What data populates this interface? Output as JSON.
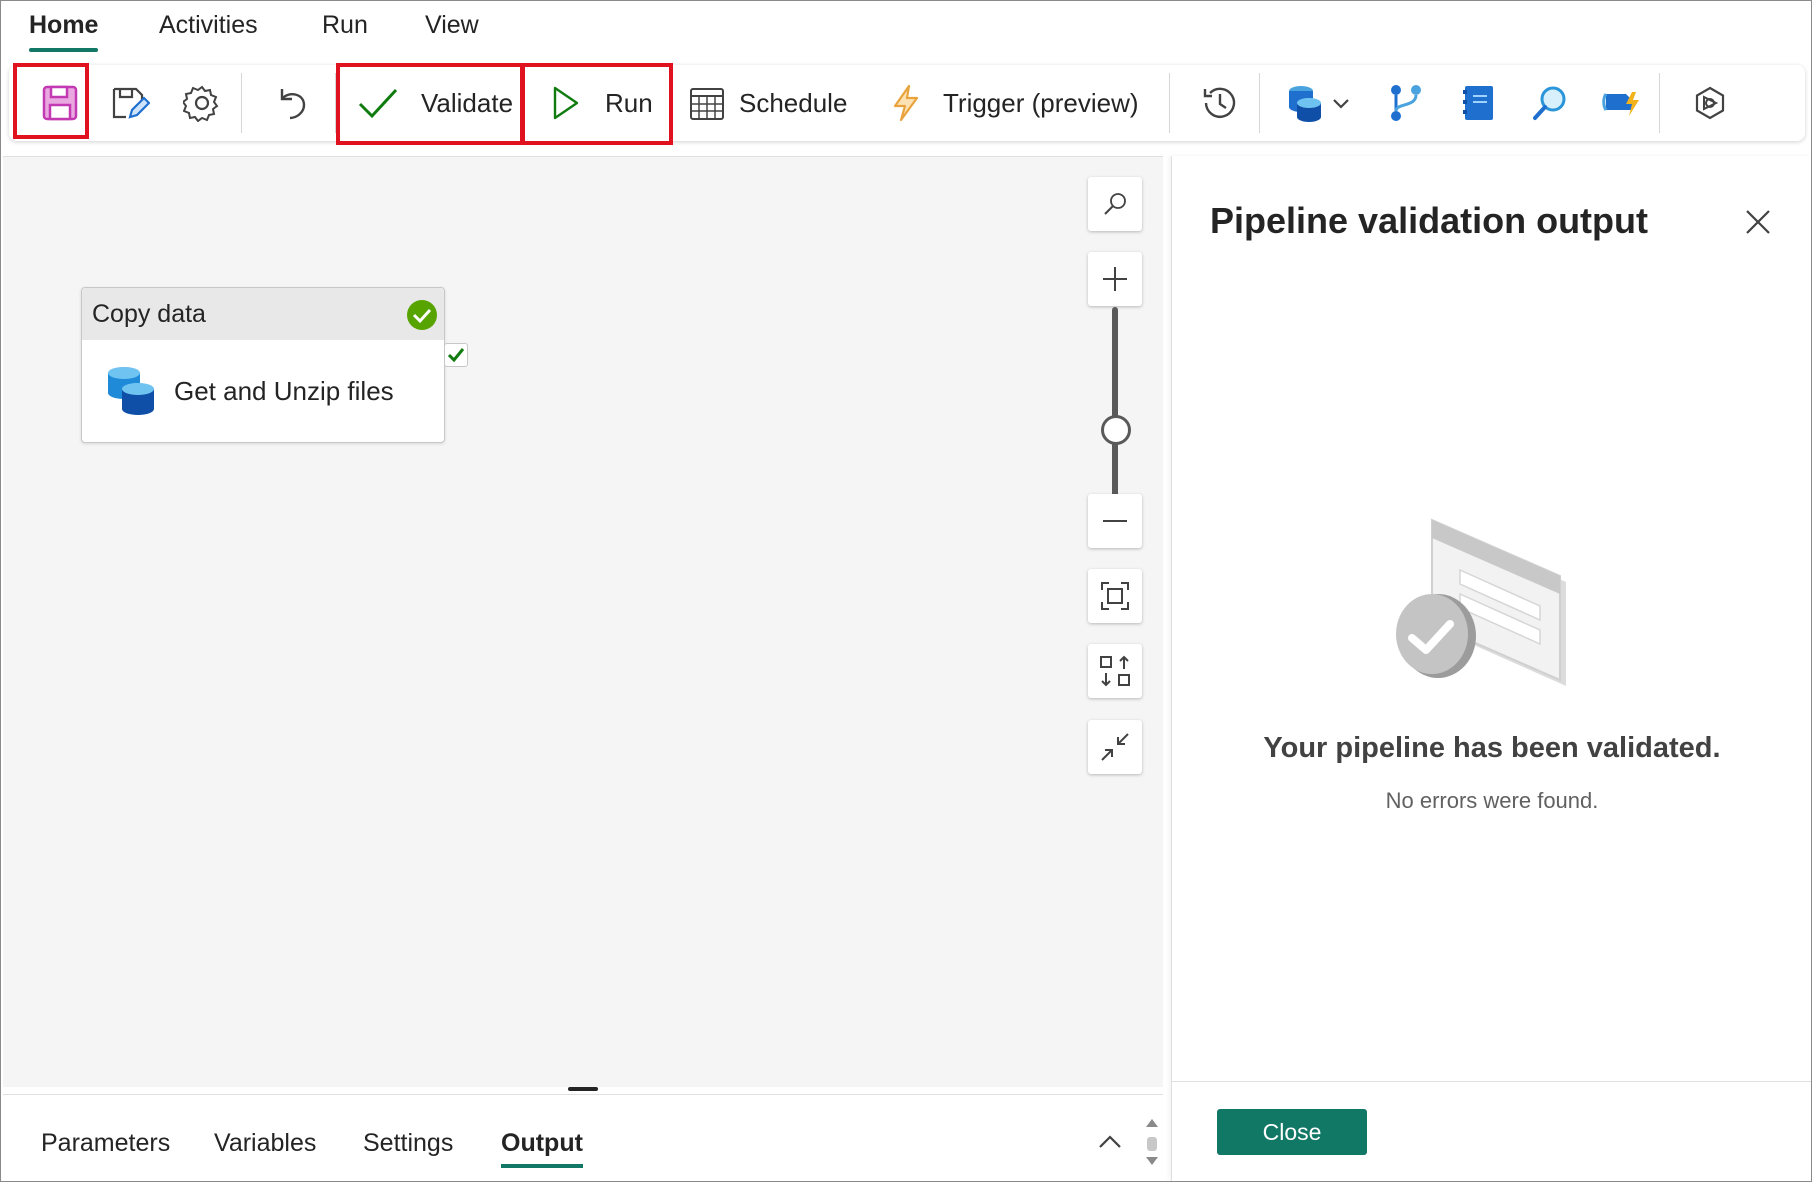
{
  "menu_tabs": [
    {
      "label": "Home",
      "active": true
    },
    {
      "label": "Activities",
      "active": false
    },
    {
      "label": "Run",
      "active": false
    },
    {
      "label": "View",
      "active": false
    }
  ],
  "toolbar": {
    "validate_label": "Validate",
    "run_label": "Run",
    "schedule_label": "Schedule",
    "trigger_label": "Trigger (preview)",
    "icons": [
      "save-icon",
      "edit-pipeline-icon",
      "settings-gear-icon",
      "undo-icon",
      "checkmark-icon",
      "play-icon",
      "calendar-icon",
      "lightning-icon",
      "history-icon",
      "database-icon",
      "chevron-down-icon",
      "branch-icon",
      "notebook-icon",
      "search-icon",
      "dataflow-icon",
      "copilot-icon"
    ],
    "highlight_color": "#e0121f"
  },
  "canvas": {
    "activity": {
      "type_label": "Copy data",
      "name": "Get and Unzip files",
      "status": "succeeded"
    }
  },
  "bottom_tabs": [
    {
      "label": "Parameters",
      "active": false
    },
    {
      "label": "Variables",
      "active": false
    },
    {
      "label": "Settings",
      "active": false
    },
    {
      "label": "Output",
      "active": true
    }
  ],
  "panel": {
    "title": "Pipeline validation output",
    "message_title": "Your pipeline has been validated.",
    "message_sub": "No errors were found.",
    "close_label": "Close"
  },
  "colors": {
    "accent": "#117865",
    "success": "#57a300",
    "save": "#c239b3"
  }
}
